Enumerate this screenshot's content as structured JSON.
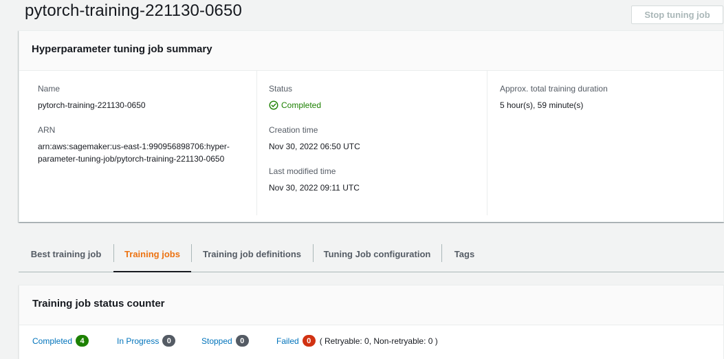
{
  "header": {
    "title": "pytorch-training-221130-0650",
    "stop_button_label": "Stop tuning job"
  },
  "summary": {
    "title": "Hyperparameter tuning job summary",
    "name_label": "Name",
    "name_value": "pytorch-training-221130-0650",
    "arn_label": "ARN",
    "arn_value": "arn:aws:sagemaker:us-east-1:990956898706:hyper-parameter-tuning-job/pytorch-training-221130-0650",
    "status_label": "Status",
    "status_value": "Completed",
    "creation_label": "Creation time",
    "creation_value": "Nov 30, 2022 06:50 UTC",
    "modified_label": "Last modified time",
    "modified_value": "Nov 30, 2022 09:11 UTC",
    "duration_label": "Approx. total training duration",
    "duration_value": "5 hour(s), 59 minute(s)"
  },
  "tabs": [
    {
      "label": "Best training job",
      "active": false
    },
    {
      "label": "Training jobs",
      "active": true
    },
    {
      "label": "Training job definitions",
      "active": false
    },
    {
      "label": "Tuning Job configuration",
      "active": false
    },
    {
      "label": "Tags",
      "active": false
    }
  ],
  "counter": {
    "title": "Training job status counter",
    "items": [
      {
        "label": "Completed",
        "count": "4"
      },
      {
        "label": "In Progress",
        "count": "0"
      },
      {
        "label": "Stopped",
        "count": "0"
      },
      {
        "label": "Failed",
        "count": "0"
      }
    ],
    "failed_note": "( Retryable: 0, Non-retryable: 0 )"
  },
  "colors": {
    "success": "#1d8102",
    "link": "#0073bb",
    "active_tab": "#ec7211",
    "failed_badge": "#d13212",
    "neutral_badge": "#545b64"
  },
  "icons": {
    "status": "check-circle-icon"
  }
}
